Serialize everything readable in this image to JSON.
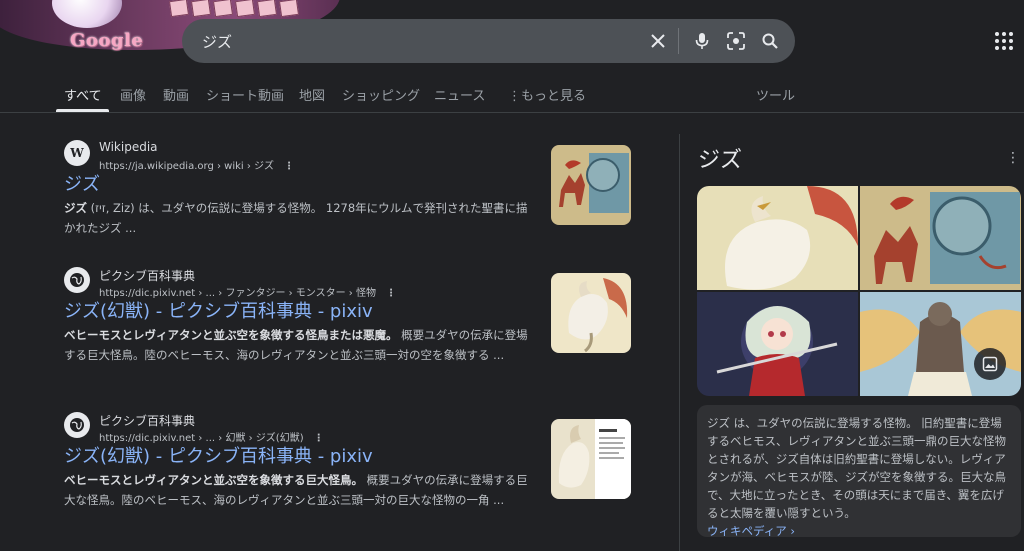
{
  "logo": {
    "text": "Google"
  },
  "search": {
    "query": "ジズ"
  },
  "tabs": [
    "すべて",
    "画像",
    "動画",
    "ショート動画",
    "地図",
    "ショッピング",
    "ニュース",
    "もっと見る",
    "ツール"
  ],
  "results": [
    {
      "site_name": "Wikipedia",
      "url": "https://ja.wikipedia.org › wiki › ジズ",
      "title": "ジズ",
      "snippet_bold": "ジズ",
      "snippet": " (זיז, Ziz) は、ユダヤの伝説に登場する怪物。 1278年にウルムで発刊された聖書に描かれたジズ ..."
    },
    {
      "site_name": "ピクシブ百科事典",
      "url": "https://dic.pixiv.net › ... › ファンタジー › モンスター › 怪物",
      "title": "ジズ(幻獣) - ピクシブ百科事典 - pixiv",
      "snippet_bold": "ベヒーモスとレヴィアタンと並ぶ空を象徴する怪鳥または悪魔。",
      "snippet": " 概要ユダヤの伝承に登場する巨大怪鳥。陸のベヒーモス、海のレヴィアタンと並ぶ三頭一対の空を象徴する ..."
    },
    {
      "site_name": "ピクシブ百科事典",
      "url": "https://dic.pixiv.net › ... › 幻獣 › ジズ(幻獣)",
      "title": "ジズ(幻獣) - ピクシブ百科事典 - pixiv",
      "snippet_bold": "ベヒーモスとレヴィアタンと並ぶ空を象徴する巨大怪鳥。",
      "snippet": " 概要ユダヤの伝承に登場する巨大な怪鳥。陸のベヒーモス、海のレヴィアタンと並ぶ三頭一対の巨大な怪物の一角 ..."
    }
  ],
  "knowledge_panel": {
    "title": "ジズ",
    "description": "ジズ は、ユダヤの伝説に登場する怪物。 旧約聖書に登場するベヒモス、レヴィアタンと並ぶ三頭一鼎の巨大な怪物とされるが、ジズ自体は旧約聖書に登場しない。レヴィアタンが海、ベヒモスが陸、ジズが空を象徴する。巨大な鳥で、大地に立ったとき、その頭は天にまで届き、翼を広げると太陽を覆い隠すという。",
    "link": "ウィキペディア ›"
  }
}
